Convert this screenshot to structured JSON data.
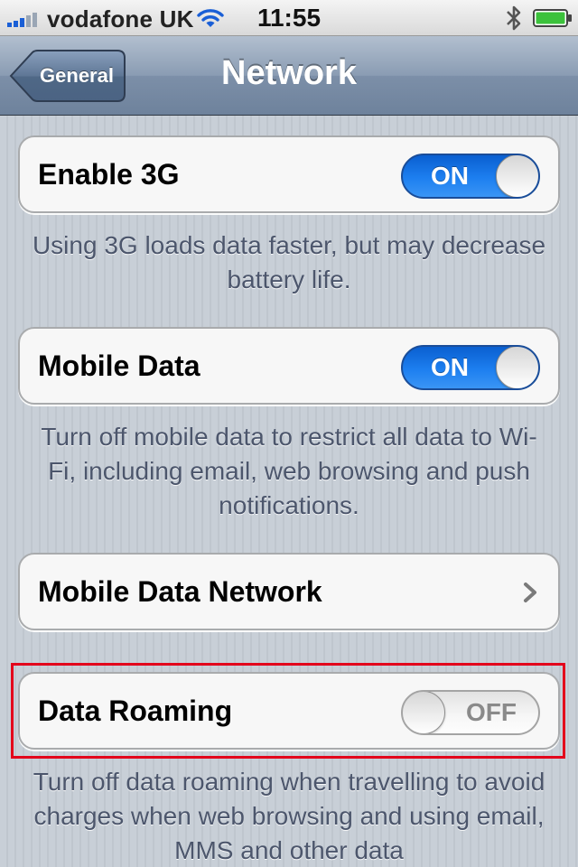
{
  "status_bar": {
    "carrier": "vodafone UK",
    "time": "11:55",
    "icons": [
      "signal-icon",
      "wifi-icon",
      "bluetooth-icon",
      "battery-icon"
    ]
  },
  "nav": {
    "back_label": "General",
    "title": "Network"
  },
  "settings": {
    "enable_3g": {
      "label": "Enable 3G",
      "state": "ON"
    },
    "enable_3g_footer": "Using 3G loads data faster, but may decrease battery life.",
    "mobile_data": {
      "label": "Mobile Data",
      "state": "ON"
    },
    "mobile_data_footer": "Turn off mobile data to restrict all data to Wi-Fi, including email, web browsing and push notifications.",
    "mobile_data_network": {
      "label": "Mobile Data Network"
    },
    "data_roaming": {
      "label": "Data Roaming",
      "state": "OFF"
    },
    "data_roaming_footer": "Turn off data roaming when travelling to avoid charges when web browsing and using email, MMS and other data"
  },
  "colors": {
    "toggle_on": "#1d7ff0",
    "highlight": "#e3001b",
    "nav_bar": "#8a9cb3"
  }
}
